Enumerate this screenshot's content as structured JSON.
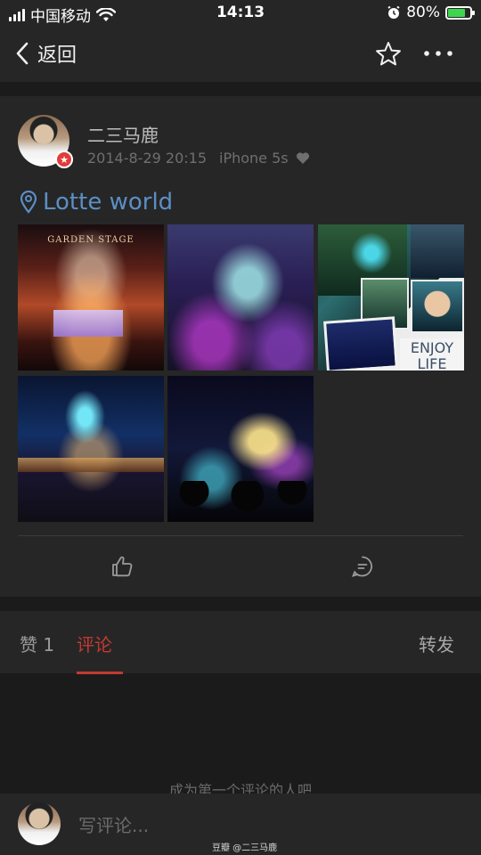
{
  "status_bar": {
    "carrier": "中国移动",
    "time": "14:13",
    "battery_percent": "80%",
    "battery_level": 0.8,
    "icons": [
      "signal-icon",
      "wifi-icon",
      "alarm-icon",
      "battery-charging-icon"
    ]
  },
  "nav": {
    "back_label": "返回",
    "icons": [
      "back-chevron-icon",
      "star-icon",
      "more-icon"
    ]
  },
  "post": {
    "username": "二三马鹿",
    "timestamp": "2014-8-29 20:15",
    "device": "iPhone 5s",
    "location": "Lotte world",
    "photos": {
      "p1_text": "GARDEN STAGE",
      "p3_text": "ENJOY LIFE",
      "count": 5
    },
    "actions": [
      "like-icon",
      "comment-icon"
    ]
  },
  "tabs": {
    "likes": "赞 1",
    "comments": "评论",
    "reposts": "转发",
    "active": "comments"
  },
  "empty_state": "成为第一个评论的人吧",
  "comment_bar": {
    "placeholder": "写评论...",
    "watermark": "豆瓣 @二三马鹿"
  },
  "colors": {
    "accent_red": "#c23a32",
    "location_blue": "#5b8fc5",
    "background": "#1b1b1b",
    "card": "#262626"
  }
}
